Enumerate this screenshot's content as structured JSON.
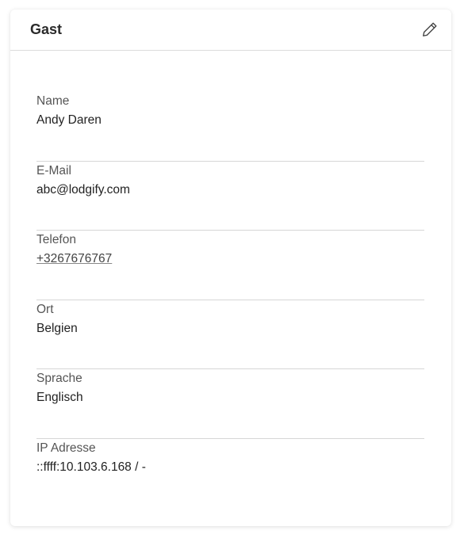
{
  "header": {
    "title": "Gast",
    "edit_icon": "pencil-icon"
  },
  "fields": {
    "name": {
      "label": "Name",
      "value": "Andy Daren"
    },
    "email": {
      "label": "E-Mail",
      "value": "abc@lodgify.com"
    },
    "phone": {
      "label": "Telefon",
      "value": "+3267676767"
    },
    "location": {
      "label": "Ort",
      "value": "Belgien"
    },
    "language": {
      "label": "Sprache",
      "value": "Englisch"
    },
    "ip": {
      "label": "IP Adresse",
      "value": "::ffff:10.103.6.168 / -"
    }
  }
}
